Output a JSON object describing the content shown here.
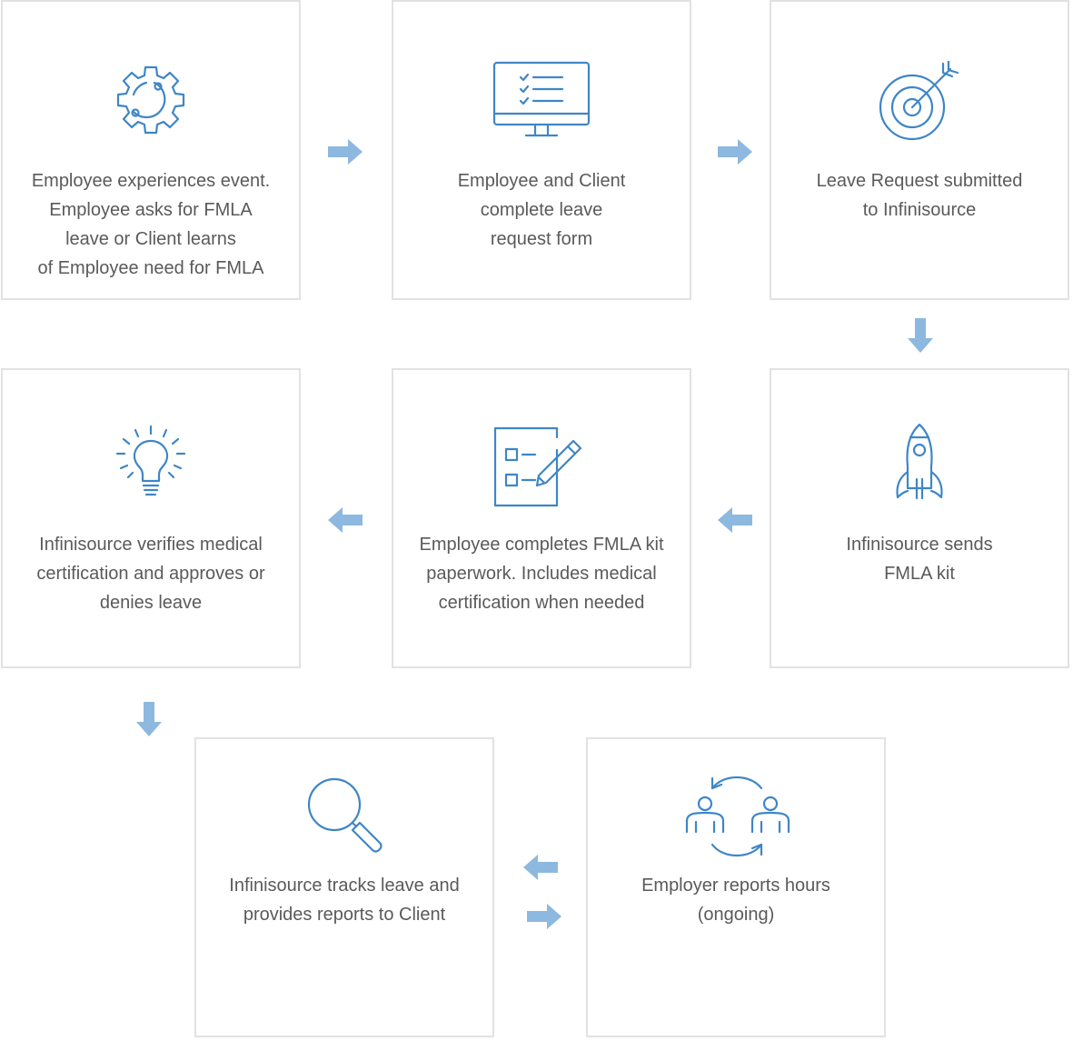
{
  "steps": [
    {
      "icon": "gear-cycle-icon",
      "text": "Employee experiences event.\nEmployee asks for FMLA\nleave or Client learns\nof Employee need for FMLA"
    },
    {
      "icon": "monitor-checklist-icon",
      "text": "Employee and Client\ncomplete leave\nrequest form"
    },
    {
      "icon": "target-arrow-icon",
      "text": "Leave Request submitted\nto Infinisource"
    },
    {
      "icon": "rocket-icon",
      "text": "Infinisource sends\nFMLA kit"
    },
    {
      "icon": "checklist-pencil-icon",
      "text": "Employee completes FMLA kit\npaperwork. Includes medical\ncertification when needed"
    },
    {
      "icon": "lightbulb-icon",
      "text": "Infinisource verifies medical\ncertification and approves or\ndenies leave"
    },
    {
      "icon": "magnifying-glass-icon",
      "text": "Infinisource tracks leave and\nprovides reports to Client"
    },
    {
      "icon": "people-exchange-icon",
      "text": "Employer reports hours\n(ongoing)"
    }
  ],
  "arrows": [
    {
      "name": "arrow-right-1-to-2",
      "direction": "right"
    },
    {
      "name": "arrow-right-2-to-3",
      "direction": "right"
    },
    {
      "name": "arrow-down-3-to-4",
      "direction": "down"
    },
    {
      "name": "arrow-left-4-to-5",
      "direction": "left"
    },
    {
      "name": "arrow-left-5-to-6",
      "direction": "left"
    },
    {
      "name": "arrow-down-6-to-7",
      "direction": "down"
    },
    {
      "name": "arrow-left-8-to-7",
      "direction": "left"
    },
    {
      "name": "arrow-right-7-to-8",
      "direction": "right"
    }
  ],
  "colors": {
    "icon": "#3f86c6",
    "arrow": "#8db8df",
    "text": "#5a5a5a",
    "border": "#e2e2e2"
  }
}
